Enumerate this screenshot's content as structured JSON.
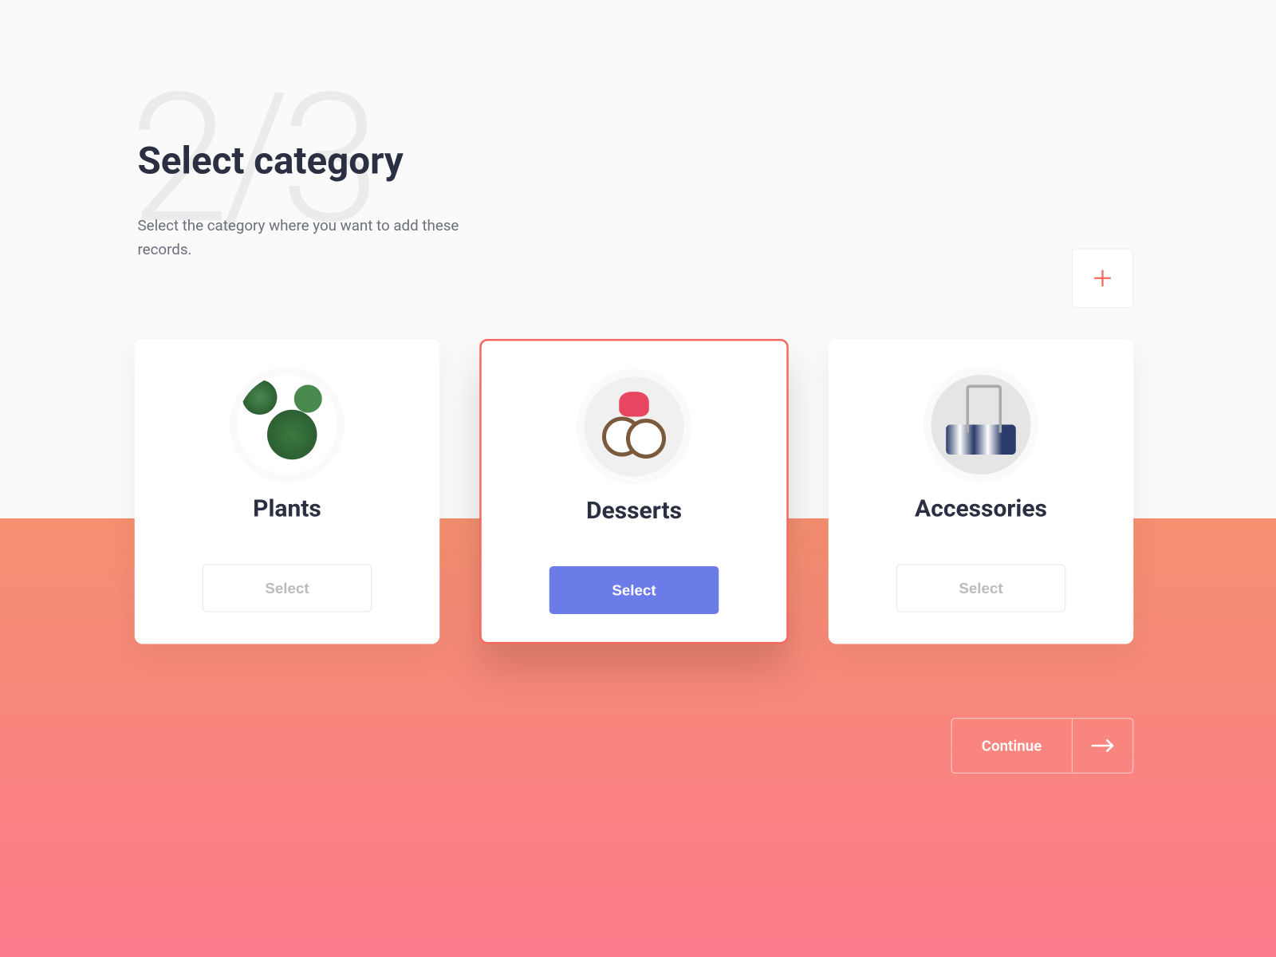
{
  "step": {
    "indicator": "2/3"
  },
  "header": {
    "title": "Select category",
    "subtitle": "Select the category where you want to add these records."
  },
  "categories": [
    {
      "name": "Plants",
      "button_label": "Select",
      "selected": false
    },
    {
      "name": "Desserts",
      "button_label": "Select",
      "selected": true
    },
    {
      "name": "Accessories",
      "button_label": "Select",
      "selected": false
    }
  ],
  "footer": {
    "continue_label": "Continue"
  },
  "colors": {
    "accent_red": "#f5685f",
    "accent_blue": "#6b7ce8",
    "gradient_top": "#f59070",
    "gradient_bottom": "#fc7b8c",
    "text_dark": "#2a3042"
  }
}
